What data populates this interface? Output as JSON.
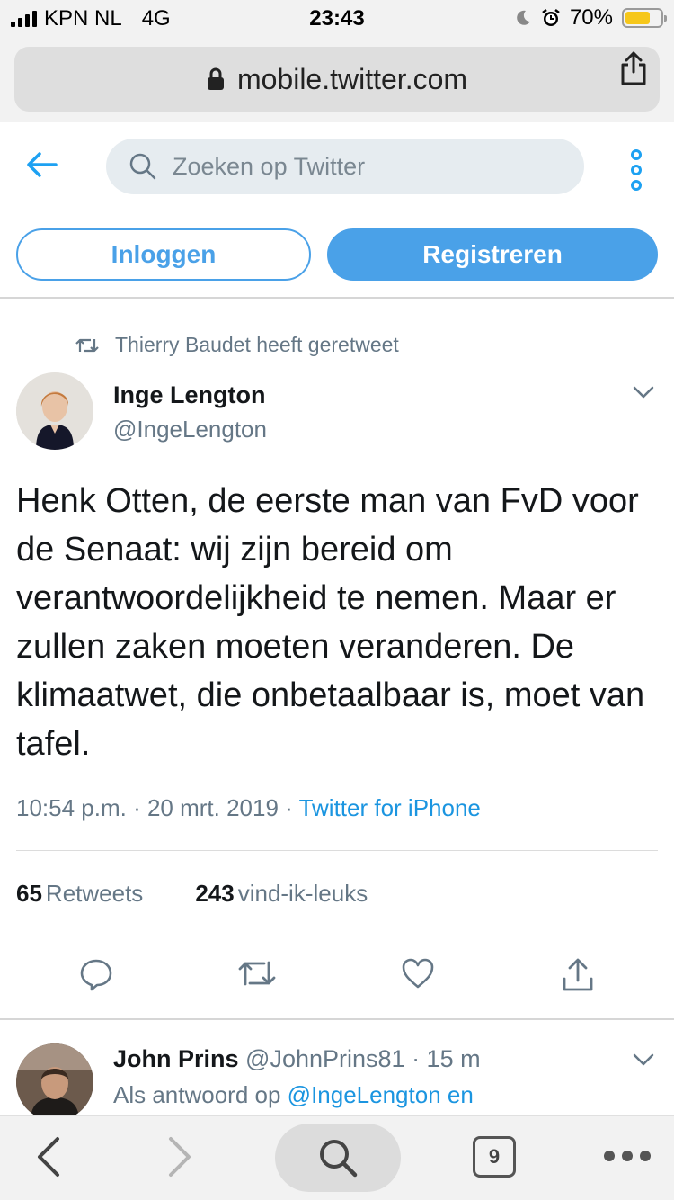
{
  "status_bar": {
    "carrier": "KPN NL",
    "network": "4G",
    "time": "23:43",
    "battery": "70%",
    "battery_level": 0.7
  },
  "browser": {
    "url": "mobile.twitter.com",
    "tab_count": "9"
  },
  "header": {
    "search_placeholder": "Zoeken op Twitter"
  },
  "auth": {
    "login_label": "Inloggen",
    "register_label": "Registreren"
  },
  "tweet": {
    "retweeted_by": "Thierry Baudet heeft geretweet",
    "author_name": "Inge Lengton",
    "author_handle": "@IngeLengton",
    "text": "Henk Otten, de eerste man van FvD voor de Senaat: wij zijn bereid om verantwoordelijkheid te nemen. Maar er zullen zaken moeten veranderen. De klimaatwet, die onbetaalbaar is, moet van tafel.",
    "timestamp": "10:54 p.m. · 20 mrt. 2019 · ",
    "source": "Twitter for iPhone",
    "retweets_count": "65",
    "retweets_label": "Retweets",
    "likes_count": "243",
    "likes_label": "vind-ik-leuks"
  },
  "reply": {
    "author_name": "John Prins",
    "author_handle": "@JohnPrins81",
    "time": " · 15 m",
    "reply_prefix": "Als antwoord op ",
    "reply_target": "@IngeLengton en"
  },
  "colors": {
    "accent": "#1da1f2",
    "button_blue": "#4aa1e8",
    "muted_text": "#657786",
    "battery_fill": "#f6c71a"
  }
}
